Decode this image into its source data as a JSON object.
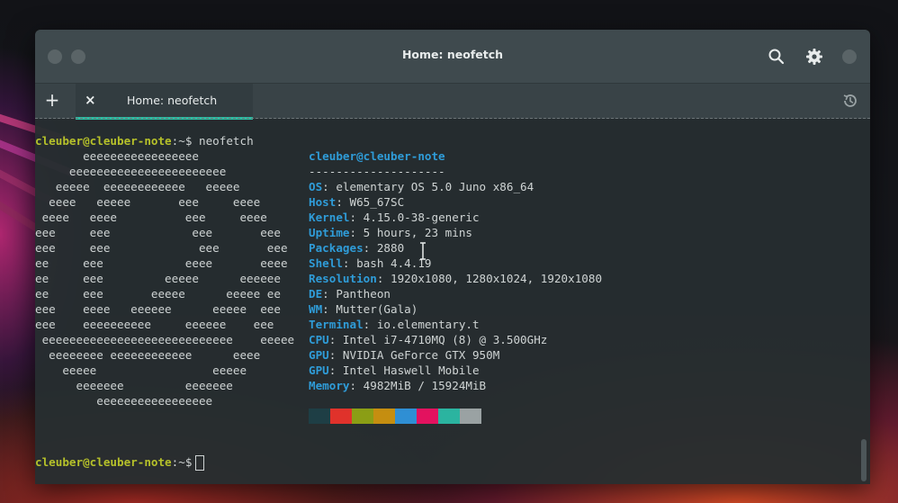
{
  "window": {
    "title": "Home: neofetch"
  },
  "tabs": [
    {
      "label": "Home: neofetch",
      "close_glyph": "×"
    }
  ],
  "tab_add_glyph": "+",
  "icons": {
    "search": "search-icon",
    "settings": "gear-icon",
    "history": "history-icon"
  },
  "terminal": {
    "prompt_user_host": "cleuber@cleuber-note",
    "prompt_path": ":~$",
    "command": " neofetch",
    "logo_lines": [
      "       eeeeeeeeeeeeeeeee",
      "     eeeeeeeeeeeeeeeeeeeeeee",
      "   eeeee  eeeeeeeeeeee   eeeee",
      "  eeee   eeeee       eee     eeee",
      " eeee   eeee          eee     eeee",
      "eee     eee            eee       eee",
      "eee     eee             eee       eee",
      "ee     eee            eeee       eeee",
      "ee     eee         eeeee      eeeeee",
      "ee     eee       eeeee      eeeee ee",
      "eee    eeee   eeeeee      eeeee  eee",
      "eee    eeeeeeeeee     eeeeee    eee",
      " eeeeeeeeeeeeeeeeeeeeeeeeeeee    eeeee",
      "  eeeeeeee eeeeeeeeeeee      eeee",
      "    eeeee                 eeeee",
      "      eeeeeee         eeeeeee",
      "         eeeeeeeeeeeeeeeee"
    ],
    "info_header": "cleuber@cleuber-note",
    "info_rule": "--------------------",
    "info": [
      {
        "key": "OS",
        "value": ": elementary OS 5.0 Juno x86_64"
      },
      {
        "key": "Host",
        "value": ": W65_67SC"
      },
      {
        "key": "Kernel",
        "value": ": 4.15.0-38-generic"
      },
      {
        "key": "Uptime",
        "value": ": 5 hours, 23 mins"
      },
      {
        "key": "Packages",
        "value": ": 2880"
      },
      {
        "key": "Shell",
        "value": ": bash 4.4.19"
      },
      {
        "key": "Resolution",
        "value": ": 1920x1080, 1280x1024, 1920x1080"
      },
      {
        "key": "DE",
        "value": ": Pantheon"
      },
      {
        "key": "WM",
        "value": ": Mutter(Gala)"
      },
      {
        "key": "Terminal",
        "value": ": io.elementary.t"
      },
      {
        "key": "CPU",
        "value": ": Intel i7-4710MQ (8) @ 3.500GHz"
      },
      {
        "key": "GPU",
        "value": ": NVIDIA GeForce GTX 950M"
      },
      {
        "key": "GPU",
        "value": ": Intel Haswell Mobile"
      },
      {
        "key": "Memory",
        "value": ": 4982MiB / 15924MiB"
      }
    ],
    "color_blocks": [
      "#1e3e45",
      "#e0322b",
      "#8b9e15",
      "#c58e10",
      "#2f8fd4",
      "#e3125f",
      "#2bb4a0",
      "#9aa2a3"
    ]
  },
  "colors": {
    "accent_tab_underline": "#2bbfa4",
    "prompt_user": "#b6c12a",
    "info_key": "#2f9cd8"
  }
}
